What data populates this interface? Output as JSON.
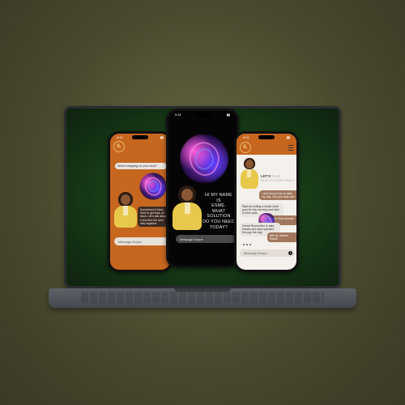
{
  "left_phone": {
    "status_time": "9:41",
    "question": "What's weighing on your mind?",
    "logo_letters": "IL",
    "reply_dark": "Sometimes it feels hard to get back on track. Let's talk about it and find the next step together.",
    "input_placeholder": "Message Ecope"
  },
  "mid_phone": {
    "status_time": "9:41",
    "greeting_line1": "HI MY NAME IS",
    "greeting_line2": "ESMÉ.",
    "greeting_line3": "WHAT SOLUTION",
    "greeting_line4": "DO YOU NEED",
    "greeting_line5": "TODAY?",
    "input_placeholder": "Message Ecope"
  },
  "right_phone": {
    "status_time": "9:41",
    "logo_letters": "IL",
    "lets_line1": "LET'S",
    "lets_word_talk": "TALK",
    "lets_line2": "WHAT TO LEARN TODAY?",
    "bubble_user_1": "I don't know how to start my day. Can you help me?",
    "bubble_bot_1": "Start by setting a small, clear goal for the morning and take a short walk.",
    "bubble_user_2": "Thank you! That sounds great.",
    "bubble_bot_2": "Great! Remember to take breaks and stay hydrated through the day.",
    "bubble_user_3": "Will do, thanks Esmé!",
    "input_placeholder": "Message Ecope"
  },
  "colors": {
    "brand_orange": "#c6661f",
    "bubble_brown": "#a2775d",
    "bubble_dark": "#3a2b23",
    "screen_green": "#1f461d"
  },
  "icons": {
    "send": "arrow-up-icon",
    "mic": "mic-icon",
    "menu": "hamburger-menu-icon"
  }
}
